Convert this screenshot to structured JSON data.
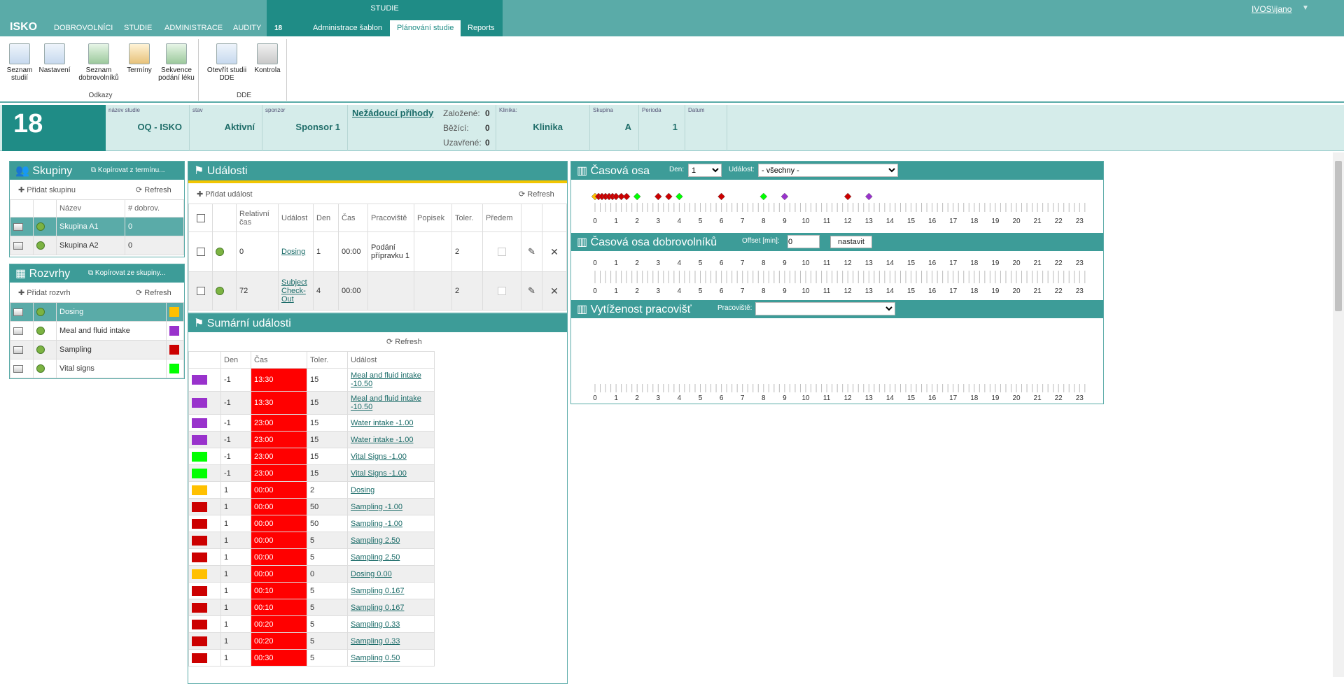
{
  "topnav": {
    "logo": "ISKO",
    "items": [
      "DOBROVOLNÍCI",
      "STUDIE",
      "ADMINISTRACE",
      "AUDITY"
    ],
    "studie_label": "STUDIE",
    "study_number": "18",
    "tabs": [
      "Administrace šablon",
      "Plánování studie",
      "Reports"
    ],
    "user": "IVOS\\ijano"
  },
  "ribbon": {
    "groups": [
      {
        "label": "Odkazy",
        "buttons": [
          "Seznam studií",
          "Nastavení",
          "Seznam dobrovolníků",
          "Termíny",
          "Sekvence podání léku"
        ]
      },
      {
        "label": "DDE",
        "buttons": [
          "Otevřít studii DDE",
          "Kontrola"
        ]
      }
    ]
  },
  "study": {
    "number": "18",
    "name_label": "název studie",
    "name": "OQ - ISKO",
    "state_label": "stav",
    "state": "Aktivní",
    "sponsor_label": "sponzor",
    "sponsor": "Sponsor 1",
    "adverse_events": "Nežádoucí příhody",
    "counts": [
      {
        "label": "Založené:",
        "value": "0"
      },
      {
        "label": "Běžící:",
        "value": "0"
      },
      {
        "label": "Uzavřené:",
        "value": "0"
      }
    ],
    "clinic_label": "Klinika:",
    "clinic": "Klinika",
    "group_label": "Skupina",
    "group": "A",
    "period_label": "Perioda",
    "period": "1",
    "date_label": "Datum",
    "date": ""
  },
  "groups": {
    "title": "Skupiny",
    "copy": "Kopírovat z termínu...",
    "add": "Přidat skupinu",
    "refresh": "Refresh",
    "headers": [
      "Název",
      "# dobrov."
    ],
    "rows": [
      {
        "name": "Skupina A1",
        "count": "0"
      },
      {
        "name": "Skupina A2",
        "count": "0"
      }
    ]
  },
  "schedules": {
    "title": "Rozvrhy",
    "copy": "Kopírovat ze skupiny...",
    "add": "Přidat rozvrh",
    "refresh": "Refresh",
    "rows": [
      {
        "name": "Dosing",
        "color": "#ffc000"
      },
      {
        "name": "Meal and fluid intake",
        "color": "#9932cc"
      },
      {
        "name": "Sampling",
        "color": "#cc0000"
      },
      {
        "name": "Vital signs",
        "color": "#00ff00"
      }
    ]
  },
  "events": {
    "title": "Události",
    "add": "Přidat událost",
    "refresh": "Refresh",
    "headers": [
      "Relativní čas",
      "Událost",
      "Den",
      "Čas",
      "Pracoviště",
      "Popisek",
      "Toler.",
      "Předem"
    ],
    "rows": [
      {
        "rel": "0",
        "event": "Dosing",
        "day": "1",
        "time": "00:00",
        "place": "Podání přípravku 1",
        "label": "",
        "tol": "2"
      },
      {
        "rel": "72",
        "event": "Subject Check-Out",
        "day": "4",
        "time": "00:00",
        "place": "",
        "label": "",
        "tol": "2"
      }
    ]
  },
  "summary": {
    "title": "Sumární události",
    "refresh": "Refresh",
    "headers": [
      "Den",
      "Čas",
      "Toler.",
      "Událost"
    ],
    "rows": [
      {
        "color": "#9932cc",
        "day": "-1",
        "time": "13:30",
        "tol": "15",
        "event": "Meal and fluid intake -10.50"
      },
      {
        "color": "#9932cc",
        "day": "-1",
        "time": "13:30",
        "tol": "15",
        "event": "Meal and fluid intake -10.50"
      },
      {
        "color": "#9932cc",
        "day": "-1",
        "time": "23:00",
        "tol": "15",
        "event": "Water intake -1.00"
      },
      {
        "color": "#9932cc",
        "day": "-1",
        "time": "23:00",
        "tol": "15",
        "event": "Water intake -1.00"
      },
      {
        "color": "#00ff00",
        "day": "-1",
        "time": "23:00",
        "tol": "15",
        "event": "Vital Signs -1.00"
      },
      {
        "color": "#00ff00",
        "day": "-1",
        "time": "23:00",
        "tol": "15",
        "event": "Vital Signs -1.00"
      },
      {
        "color": "#ffc000",
        "day": "1",
        "time": "00:00",
        "tol": "2",
        "event": "Dosing"
      },
      {
        "color": "#cc0000",
        "day": "1",
        "time": "00:00",
        "tol": "50",
        "event": "Sampling -1.00"
      },
      {
        "color": "#cc0000",
        "day": "1",
        "time": "00:00",
        "tol": "50",
        "event": "Sampling -1.00"
      },
      {
        "color": "#cc0000",
        "day": "1",
        "time": "00:00",
        "tol": "5",
        "event": "Sampling 2.50"
      },
      {
        "color": "#cc0000",
        "day": "1",
        "time": "00:00",
        "tol": "5",
        "event": "Sampling 2.50"
      },
      {
        "color": "#ffc000",
        "day": "1",
        "time": "00:00",
        "tol": "0",
        "event": "Dosing 0.00"
      },
      {
        "color": "#cc0000",
        "day": "1",
        "time": "00:10",
        "tol": "5",
        "event": "Sampling 0.167"
      },
      {
        "color": "#cc0000",
        "day": "1",
        "time": "00:10",
        "tol": "5",
        "event": "Sampling 0.167"
      },
      {
        "color": "#cc0000",
        "day": "1",
        "time": "00:20",
        "tol": "5",
        "event": "Sampling 0.33"
      },
      {
        "color": "#cc0000",
        "day": "1",
        "time": "00:20",
        "tol": "5",
        "event": "Sampling 0.33"
      },
      {
        "color": "#cc0000",
        "day": "1",
        "time": "00:30",
        "tol": "5",
        "event": "Sampling 0.50"
      }
    ]
  },
  "timeline": {
    "title": "Časová osa",
    "day_label": "Den:",
    "day_value": "1",
    "event_label": "Událost:",
    "event_value": "- všechny -",
    "hours": [
      "0",
      "1",
      "2",
      "3",
      "4",
      "5",
      "6",
      "7",
      "8",
      "9",
      "10",
      "11",
      "12",
      "13",
      "14",
      "15",
      "16",
      "17",
      "18",
      "19",
      "20",
      "21",
      "22",
      "23"
    ],
    "markers": [
      {
        "hour": 0.0,
        "color": "#ffc000"
      },
      {
        "hour": 0.17,
        "color": "#cc0000"
      },
      {
        "hour": 0.33,
        "color": "#cc0000"
      },
      {
        "hour": 0.5,
        "color": "#cc0000"
      },
      {
        "hour": 0.67,
        "color": "#cc0000"
      },
      {
        "hour": 0.83,
        "color": "#cc0000"
      },
      {
        "hour": 1.0,
        "color": "#cc0000"
      },
      {
        "hour": 1.25,
        "color": "#cc0000"
      },
      {
        "hour": 1.5,
        "color": "#cc0000"
      },
      {
        "hour": 2.0,
        "color": "#00ff00"
      },
      {
        "hour": 3.0,
        "color": "#cc0000"
      },
      {
        "hour": 3.5,
        "color": "#cc0000"
      },
      {
        "hour": 4.0,
        "color": "#00ff00"
      },
      {
        "hour": 6.0,
        "color": "#cc0000"
      },
      {
        "hour": 8.0,
        "color": "#00ff00"
      },
      {
        "hour": 9.0,
        "color": "#9932cc"
      },
      {
        "hour": 12.0,
        "color": "#cc0000"
      },
      {
        "hour": 13.0,
        "color": "#9932cc"
      }
    ]
  },
  "volunteer_timeline": {
    "title": "Časová osa dobrovolníků",
    "offset_label": "Offset [min]:",
    "offset_value": "0",
    "set_button": "nastavit"
  },
  "workload": {
    "title": "Vytíženost pracovišť",
    "place_label": "Pracoviště:",
    "place_value": ""
  }
}
